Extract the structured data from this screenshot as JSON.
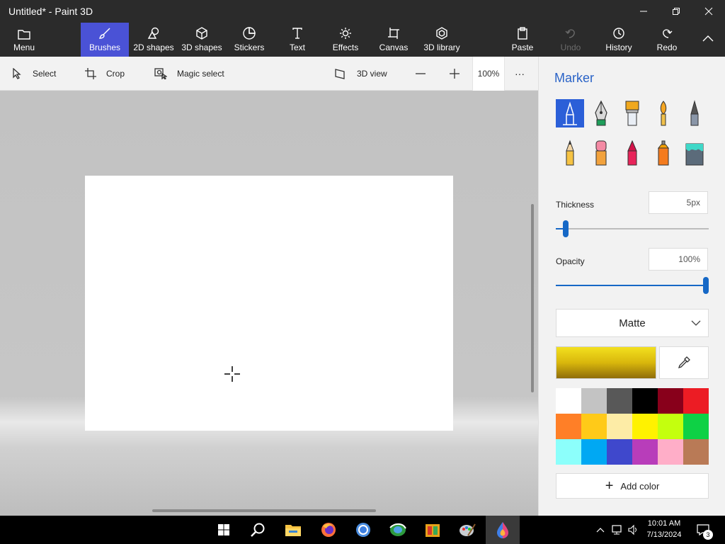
{
  "window": {
    "title": "Untitled* - Paint 3D"
  },
  "ribbon": {
    "menu_label": "Menu",
    "tabs": [
      {
        "label": "Brushes",
        "icon": "brush-icon",
        "active": true
      },
      {
        "label": "2D shapes",
        "icon": "2d-shapes-icon"
      },
      {
        "label": "3D shapes",
        "icon": "3d-shapes-icon"
      },
      {
        "label": "Stickers",
        "icon": "stickers-icon"
      },
      {
        "label": "Text",
        "icon": "text-icon"
      },
      {
        "label": "Effects",
        "icon": "effects-icon"
      },
      {
        "label": "Canvas",
        "icon": "canvas-icon"
      },
      {
        "label": "3D library",
        "icon": "3d-library-icon"
      }
    ],
    "actions": [
      {
        "label": "Paste",
        "icon": "paste-icon"
      },
      {
        "label": "Undo",
        "icon": "undo-icon",
        "disabled": true
      },
      {
        "label": "History",
        "icon": "history-icon"
      },
      {
        "label": "Redo",
        "icon": "redo-icon"
      }
    ]
  },
  "toolbar": {
    "select_label": "Select",
    "crop_label": "Crop",
    "magic_select_label": "Magic select",
    "view3d_label": "3D view",
    "zoom_value": "100%",
    "more_label": "···"
  },
  "panel": {
    "title": "Marker",
    "brushes": [
      "marker",
      "calligraphy-pen",
      "oil-brush",
      "watercolor",
      "pixel-pen",
      "pencil",
      "eraser",
      "crayon",
      "spray-can",
      "fill"
    ],
    "thickness_label": "Thickness",
    "thickness_value": "5px",
    "thickness_fraction": 0.05,
    "opacity_label": "Opacity",
    "opacity_value": "100%",
    "opacity_fraction": 1.0,
    "finish_value": "Matte",
    "current_color": "#e8c810",
    "palette": [
      "#ffffff",
      "#c3c3c3",
      "#585858",
      "#000000",
      "#88001b",
      "#ec1c24",
      "#ff7f27",
      "#ffca18",
      "#fdeca6",
      "#fff200",
      "#c4ff0e",
      "#0ed145",
      "#8cfffb",
      "#00a8f3",
      "#3f48cc",
      "#b83dba",
      "#ffaec8",
      "#b97a56"
    ],
    "add_color_label": "Add color"
  },
  "taskbar": {
    "apps": [
      "windows-start-icon",
      "search-icon",
      "file-explorer-icon",
      "firefox-icon",
      "chrome-icon",
      "edge-icon",
      "store-icon",
      "paint-icon",
      "paint3d-icon"
    ],
    "time": "10:01 AM",
    "date": "7/13/2024",
    "notifications": "3"
  }
}
